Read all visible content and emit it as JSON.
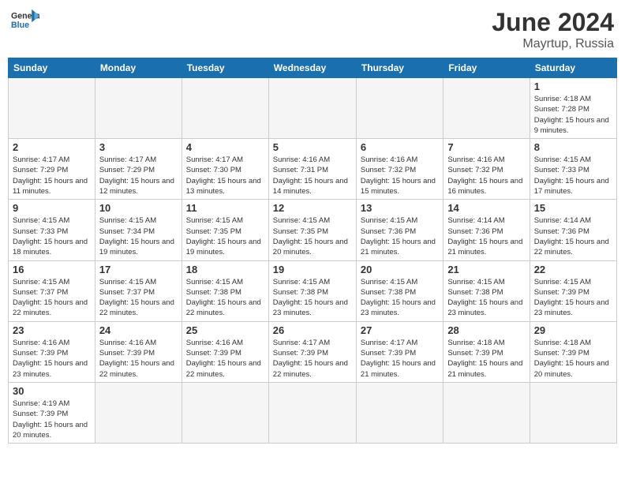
{
  "header": {
    "logo_general": "General",
    "logo_blue": "Blue",
    "month_year": "June 2024",
    "location": "Mayrtup, Russia"
  },
  "days_of_week": [
    "Sunday",
    "Monday",
    "Tuesday",
    "Wednesday",
    "Thursday",
    "Friday",
    "Saturday"
  ],
  "weeks": [
    [
      {
        "day": "",
        "info": ""
      },
      {
        "day": "",
        "info": ""
      },
      {
        "day": "",
        "info": ""
      },
      {
        "day": "",
        "info": ""
      },
      {
        "day": "",
        "info": ""
      },
      {
        "day": "",
        "info": ""
      },
      {
        "day": "1",
        "info": "Sunrise: 4:18 AM\nSunset: 7:28 PM\nDaylight: 15 hours and 9 minutes."
      }
    ],
    [
      {
        "day": "2",
        "info": "Sunrise: 4:17 AM\nSunset: 7:29 PM\nDaylight: 15 hours and 11 minutes."
      },
      {
        "day": "3",
        "info": "Sunrise: 4:17 AM\nSunset: 7:29 PM\nDaylight: 15 hours and 12 minutes."
      },
      {
        "day": "4",
        "info": "Sunrise: 4:17 AM\nSunset: 7:30 PM\nDaylight: 15 hours and 13 minutes."
      },
      {
        "day": "5",
        "info": "Sunrise: 4:16 AM\nSunset: 7:31 PM\nDaylight: 15 hours and 14 minutes."
      },
      {
        "day": "6",
        "info": "Sunrise: 4:16 AM\nSunset: 7:32 PM\nDaylight: 15 hours and 15 minutes."
      },
      {
        "day": "7",
        "info": "Sunrise: 4:16 AM\nSunset: 7:32 PM\nDaylight: 15 hours and 16 minutes."
      },
      {
        "day": "8",
        "info": "Sunrise: 4:15 AM\nSunset: 7:33 PM\nDaylight: 15 hours and 17 minutes."
      }
    ],
    [
      {
        "day": "9",
        "info": "Sunrise: 4:15 AM\nSunset: 7:33 PM\nDaylight: 15 hours and 18 minutes."
      },
      {
        "day": "10",
        "info": "Sunrise: 4:15 AM\nSunset: 7:34 PM\nDaylight: 15 hours and 19 minutes."
      },
      {
        "day": "11",
        "info": "Sunrise: 4:15 AM\nSunset: 7:35 PM\nDaylight: 15 hours and 19 minutes."
      },
      {
        "day": "12",
        "info": "Sunrise: 4:15 AM\nSunset: 7:35 PM\nDaylight: 15 hours and 20 minutes."
      },
      {
        "day": "13",
        "info": "Sunrise: 4:15 AM\nSunset: 7:36 PM\nDaylight: 15 hours and 21 minutes."
      },
      {
        "day": "14",
        "info": "Sunrise: 4:14 AM\nSunset: 7:36 PM\nDaylight: 15 hours and 21 minutes."
      },
      {
        "day": "15",
        "info": "Sunrise: 4:14 AM\nSunset: 7:36 PM\nDaylight: 15 hours and 22 minutes."
      }
    ],
    [
      {
        "day": "16",
        "info": "Sunrise: 4:15 AM\nSunset: 7:37 PM\nDaylight: 15 hours and 22 minutes."
      },
      {
        "day": "17",
        "info": "Sunrise: 4:15 AM\nSunset: 7:37 PM\nDaylight: 15 hours and 22 minutes."
      },
      {
        "day": "18",
        "info": "Sunrise: 4:15 AM\nSunset: 7:38 PM\nDaylight: 15 hours and 22 minutes."
      },
      {
        "day": "19",
        "info": "Sunrise: 4:15 AM\nSunset: 7:38 PM\nDaylight: 15 hours and 23 minutes."
      },
      {
        "day": "20",
        "info": "Sunrise: 4:15 AM\nSunset: 7:38 PM\nDaylight: 15 hours and 23 minutes."
      },
      {
        "day": "21",
        "info": "Sunrise: 4:15 AM\nSunset: 7:38 PM\nDaylight: 15 hours and 23 minutes."
      },
      {
        "day": "22",
        "info": "Sunrise: 4:15 AM\nSunset: 7:39 PM\nDaylight: 15 hours and 23 minutes."
      }
    ],
    [
      {
        "day": "23",
        "info": "Sunrise: 4:16 AM\nSunset: 7:39 PM\nDaylight: 15 hours and 23 minutes."
      },
      {
        "day": "24",
        "info": "Sunrise: 4:16 AM\nSunset: 7:39 PM\nDaylight: 15 hours and 22 minutes."
      },
      {
        "day": "25",
        "info": "Sunrise: 4:16 AM\nSunset: 7:39 PM\nDaylight: 15 hours and 22 minutes."
      },
      {
        "day": "26",
        "info": "Sunrise: 4:17 AM\nSunset: 7:39 PM\nDaylight: 15 hours and 22 minutes."
      },
      {
        "day": "27",
        "info": "Sunrise: 4:17 AM\nSunset: 7:39 PM\nDaylight: 15 hours and 21 minutes."
      },
      {
        "day": "28",
        "info": "Sunrise: 4:18 AM\nSunset: 7:39 PM\nDaylight: 15 hours and 21 minutes."
      },
      {
        "day": "29",
        "info": "Sunrise: 4:18 AM\nSunset: 7:39 PM\nDaylight: 15 hours and 20 minutes."
      }
    ],
    [
      {
        "day": "30",
        "info": "Sunrise: 4:19 AM\nSunset: 7:39 PM\nDaylight: 15 hours and 20 minutes."
      },
      {
        "day": "",
        "info": ""
      },
      {
        "day": "",
        "info": ""
      },
      {
        "day": "",
        "info": ""
      },
      {
        "day": "",
        "info": ""
      },
      {
        "day": "",
        "info": ""
      },
      {
        "day": "",
        "info": ""
      }
    ]
  ]
}
